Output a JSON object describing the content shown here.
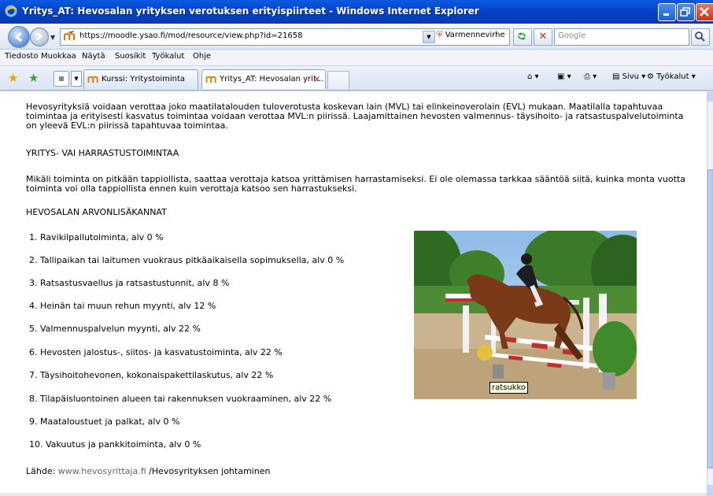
{
  "window": {
    "title": "Yritys_AT: Hevosalan yrityksen verotuksen erityispiirteet - Windows Internet Explorer"
  },
  "navbar": {
    "url": "https://moodle.ysao.fi/mod/resource/view.php?id=21658",
    "cert_error": "Varmennevirhe",
    "search_placeholder": "Google"
  },
  "menu": [
    "Tiedosto",
    "Muokkaa",
    "Näytä",
    "Suosikit",
    "Työkalut",
    "Ohje"
  ],
  "tabs": [
    {
      "label": "Kurssi: Yritystoiminta",
      "active": false
    },
    {
      "label": "Yritys_AT: Hevosalan yrit...",
      "active": true,
      "close": "✕"
    }
  ],
  "commandbar": {
    "page": "Sivu",
    "tools": "Työkalut"
  },
  "content": {
    "intro": [
      "Hevosyrityksiä voidaan verottaa joko maatilatalouden tuloverotusta koskevan lain (MVL) tai elinkeinoverolain (EVL) mukaan. Maatilalla tapahtuvaa",
      "toimintaa ja erityisesti kasvatus toimintaa voidaan verottaa MVL:n piirissä. Laajamittainen hevosten valmennus- täysihoito- ja ratsastuspalvelutoiminta",
      "on yleevä EVL:n piirissä tapahtuvaa toimintaa."
    ],
    "heading1": "YRITYS- VAI HARRASTUSTOIMINTAA",
    "para2": [
      "Mikäli toiminta on pitkään tappiollista, saattaa verottaja katsoa yrittämisen harrastamiseksi. Ei ole olemassa tarkkaa sääntöä siitä, kuinka monta vuotta",
      "toiminta voi olla tappiollista ennen kuin verottaja katsoo sen harrastukseksi."
    ],
    "heading2": "HEVOSALAN ARVONLISÄKANNAT",
    "list": [
      "1. Ravikilpailutoiminta, alv 0 %",
      "2. Tallipaikan tai laitumen vuokraus pitkäaikaisella sopimuksella, alv 0 %",
      "3. Ratsastusvaellus ja ratsastustunnit, alv 8 %",
      "4. Heinän tai muun rehun myynti, alv 12 %",
      "5. Valmennuspalvelun myynti, alv 22 %",
      "6. Hevosten jalostus-, siitos- ja kasvatustoiminta, alv 22 %",
      "7. Täysihoitohevonen, kokonaispakettilaskutus, alv 22 %",
      "8. Tilapäisluontoinen alueen tai rakennuksen vuokraaminen, alv 22 %",
      "9. Maataloustuet ja palkat, alv 0 %",
      "10. Vakuutus ja pankkitoiminta, alv 0 %"
    ],
    "source_label": "Lähde:",
    "source_link": "www.hevosyrittaja.fi",
    "source_rest": "/Hevosyrityksen johtaminen",
    "image_tooltip": "ratsukko"
  },
  "colors": {
    "titlebar": "#0443c9",
    "link": "#666666"
  }
}
